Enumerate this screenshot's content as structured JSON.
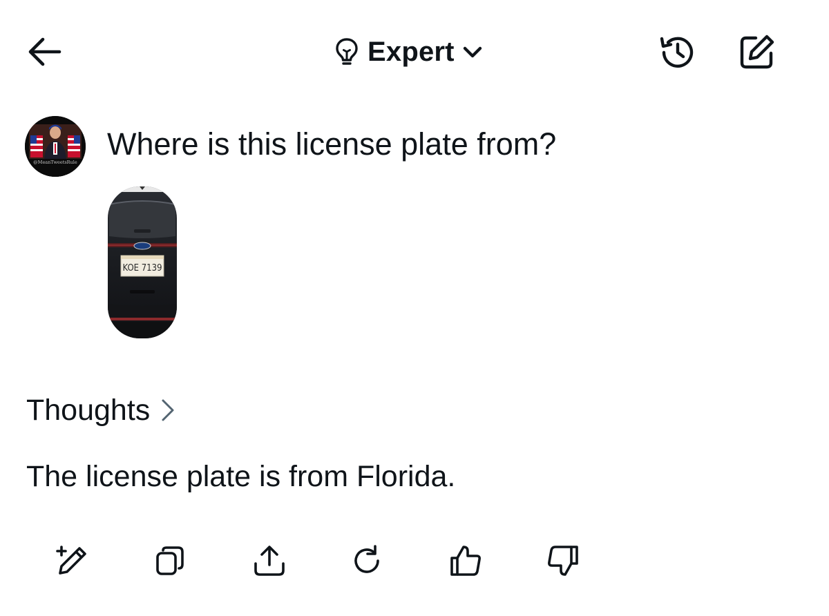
{
  "header": {
    "mode_label": "Expert",
    "icons": {
      "back": "arrow-left-icon",
      "mode": "lightbulb-icon",
      "dropdown": "chevron-down-icon",
      "history": "history-icon",
      "compose": "compose-icon"
    }
  },
  "conversation": {
    "question": "Where is this license plate from?",
    "avatar_watermark": "@MeanTweetsRule",
    "attachment": {
      "plate_text": "KOE 7139"
    },
    "thoughts_label": "Thoughts",
    "answer": "The license plate is from Florida."
  },
  "actions": {
    "icons": [
      "edit-icon",
      "copy-icon",
      "share-icon",
      "regenerate-icon",
      "thumbs-up-icon",
      "thumbs-down-icon"
    ]
  },
  "colors": {
    "text": "#0f1419",
    "muted": "#536471",
    "background": "#ffffff"
  }
}
